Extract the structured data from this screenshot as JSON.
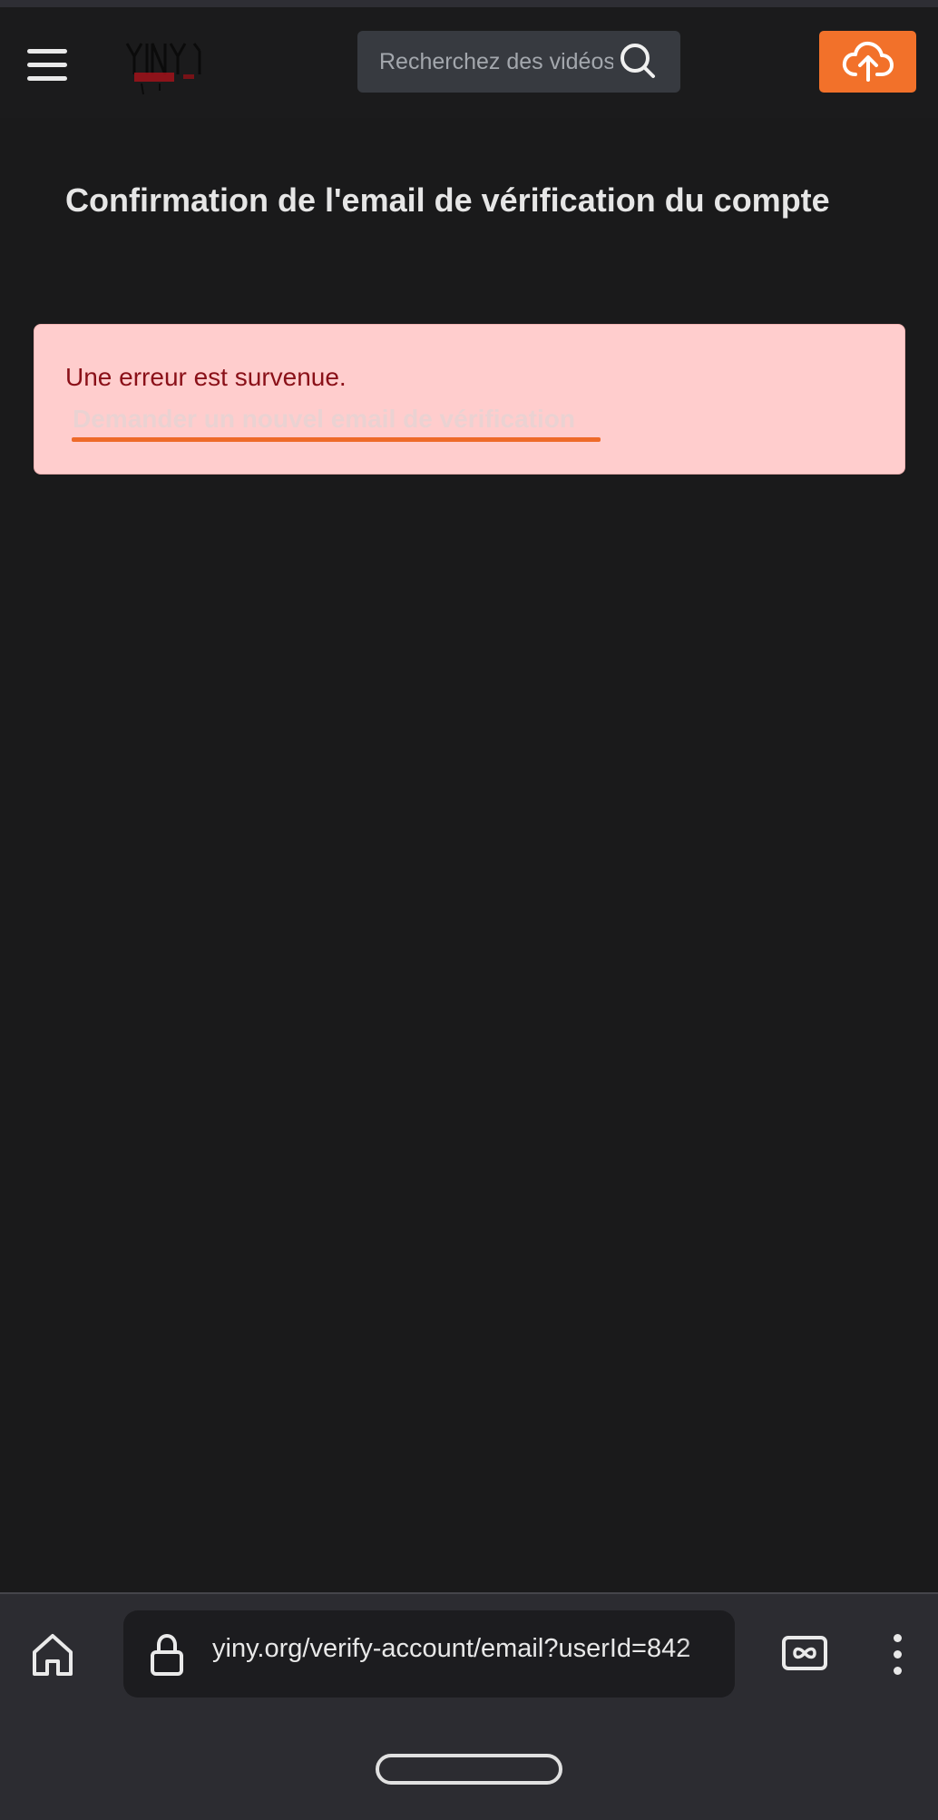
{
  "header": {
    "search": {
      "placeholder": "Recherchez des vidéos"
    },
    "logo_text": "YINY.ORG"
  },
  "main": {
    "title": "Confirmation de l'email de vérification du compte",
    "alert": {
      "message": "Une erreur est survenue.",
      "link_label": "Demander un nouvel email de vérification"
    }
  },
  "browser": {
    "url": "yiny.org/verify-account/email?userId=842"
  },
  "colors": {
    "background": "#1a1a1b",
    "accent": "#f2712a",
    "alert_bg": "#ffcdcd",
    "alert_text": "#8a1018"
  },
  "icons": [
    "menu-icon",
    "logo",
    "search-icon",
    "cloud-upload-icon",
    "home-icon",
    "lock-icon",
    "tabs-icon",
    "more-vertical-icon"
  ]
}
